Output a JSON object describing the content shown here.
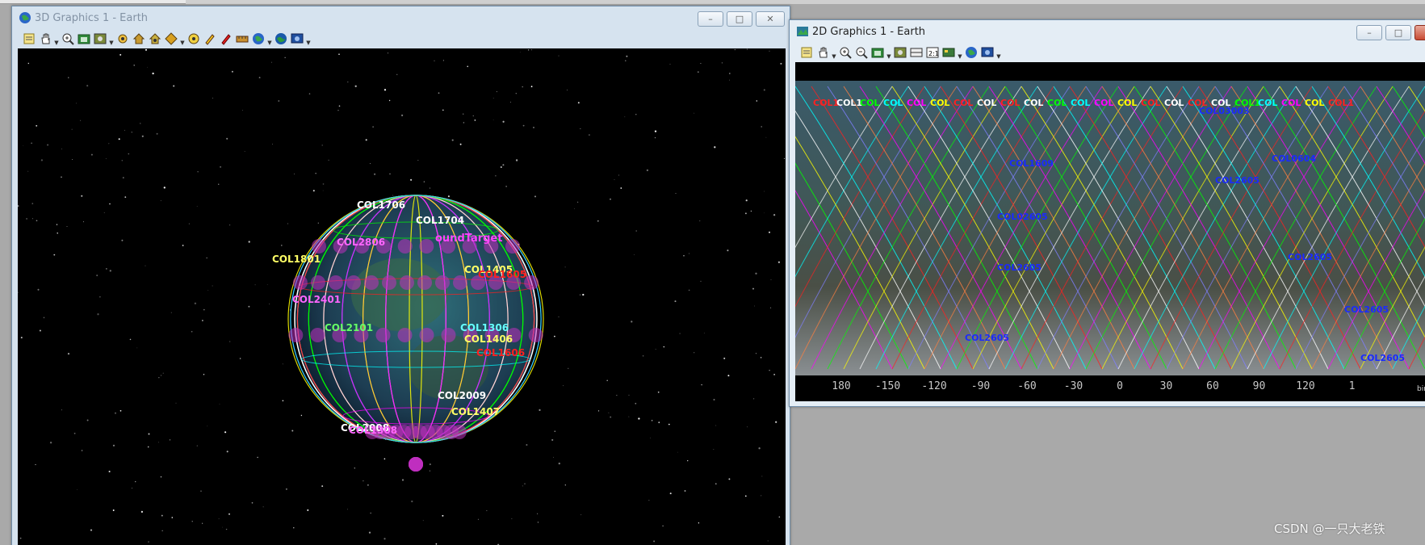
{
  "window3d": {
    "title": "3D Graphics 1 - Earth"
  },
  "window2d": {
    "title": "2D Graphics 1 - Earth"
  },
  "caption_buttons": {
    "minimize": "–",
    "maximize": "□",
    "close": "✕"
  },
  "toolbar3d_icons": [
    "properties-icon",
    "pan-icon",
    "zoom-in-icon",
    "snapshot-icon",
    "record-icon",
    "view-from-icon",
    "home-view-icon",
    "zoom-to-icon",
    "orient-icon",
    "measure-icon",
    "pencil-icon",
    "marker-icon",
    "ruler-icon",
    "globe-icon",
    "earth-icon",
    "settings-icon"
  ],
  "toolbar2d_icons": [
    "properties-icon",
    "pan-icon",
    "zoom-in-icon",
    "zoom-out-icon",
    "snapshot-icon",
    "record-icon",
    "map-projection-icon",
    "scale-1to1-icon",
    "map-layers-icon",
    "globe-icon",
    "settings-icon"
  ],
  "scene3d_labels": {
    "ground_target": "oundTarget",
    "sat_labels": [
      {
        "t": "COL1704",
        "c": "#ffffff"
      },
      {
        "t": "COL1405",
        "c": "#ffff66"
      },
      {
        "t": "COL1605",
        "c": "#ff2020"
      },
      {
        "t": "COL1406",
        "c": "#ffff66"
      },
      {
        "t": "COL1606",
        "c": "#ff2020"
      },
      {
        "t": "COL1407",
        "c": "#ffff66"
      },
      {
        "t": "COL1706",
        "c": "#ffffff"
      },
      {
        "t": "COL2806",
        "c": "#ff66ff"
      },
      {
        "t": "COL2008",
        "c": "#ffffff"
      },
      {
        "t": "COL1801",
        "c": "#ffff66"
      },
      {
        "t": "COL2401",
        "c": "#ff66ff"
      },
      {
        "t": "COL2101",
        "c": "#66ff66"
      },
      {
        "t": "COL2009",
        "c": "#ffffff"
      },
      {
        "t": "COL1306",
        "c": "#66ffff"
      },
      {
        "t": "COL1308",
        "c": "#ff66ff"
      }
    ],
    "colors": {
      "yellow": "#ffff00",
      "magenta": "#ff00ff",
      "white": "#ffffff",
      "green": "#00ff00",
      "red": "#ff2020",
      "cyan": "#00ffff",
      "blue": "#1030ff"
    }
  },
  "map2d": {
    "longitude_ticks": [
      "180",
      "-150",
      "-120",
      "-90",
      "-60",
      "-30",
      "0",
      "30",
      "60",
      "90",
      "120",
      "1"
    ],
    "attribution": "bing",
    "top_labels": [
      "COL1",
      "COL1",
      "COL",
      "COL",
      "COL",
      "COL",
      "COL",
      "COL",
      "COL",
      "COL",
      "COL",
      "COL",
      "COL",
      "COL",
      "COL",
      "COL",
      "COL",
      "COL",
      "COL1",
      "COL",
      "COL",
      "COL",
      "COL1"
    ],
    "blue_labels": [
      "COL03003",
      "COL0604",
      "COL1609",
      "COL02605",
      "COL2605",
      "COL2605",
      "COL2605",
      "COL2605",
      "COL2605",
      "COL2605"
    ]
  },
  "watermark": "CSDN @一只大老铁"
}
